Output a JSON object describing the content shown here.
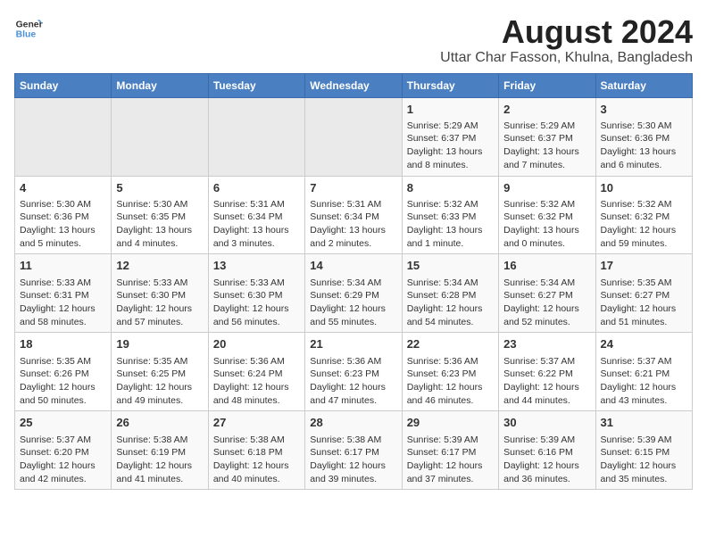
{
  "header": {
    "logo_line1": "General",
    "logo_line2": "Blue",
    "title": "August 2024",
    "subtitle": "Uttar Char Fasson, Khulna, Bangladesh"
  },
  "weekdays": [
    "Sunday",
    "Monday",
    "Tuesday",
    "Wednesday",
    "Thursday",
    "Friday",
    "Saturday"
  ],
  "weeks": [
    [
      {
        "day": "",
        "content": ""
      },
      {
        "day": "",
        "content": ""
      },
      {
        "day": "",
        "content": ""
      },
      {
        "day": "",
        "content": ""
      },
      {
        "day": "1",
        "content": "Sunrise: 5:29 AM\nSunset: 6:37 PM\nDaylight: 13 hours\nand 8 minutes."
      },
      {
        "day": "2",
        "content": "Sunrise: 5:29 AM\nSunset: 6:37 PM\nDaylight: 13 hours\nand 7 minutes."
      },
      {
        "day": "3",
        "content": "Sunrise: 5:30 AM\nSunset: 6:36 PM\nDaylight: 13 hours\nand 6 minutes."
      }
    ],
    [
      {
        "day": "4",
        "content": "Sunrise: 5:30 AM\nSunset: 6:36 PM\nDaylight: 13 hours\nand 5 minutes."
      },
      {
        "day": "5",
        "content": "Sunrise: 5:30 AM\nSunset: 6:35 PM\nDaylight: 13 hours\nand 4 minutes."
      },
      {
        "day": "6",
        "content": "Sunrise: 5:31 AM\nSunset: 6:34 PM\nDaylight: 13 hours\nand 3 minutes."
      },
      {
        "day": "7",
        "content": "Sunrise: 5:31 AM\nSunset: 6:34 PM\nDaylight: 13 hours\nand 2 minutes."
      },
      {
        "day": "8",
        "content": "Sunrise: 5:32 AM\nSunset: 6:33 PM\nDaylight: 13 hours\nand 1 minute."
      },
      {
        "day": "9",
        "content": "Sunrise: 5:32 AM\nSunset: 6:32 PM\nDaylight: 13 hours\nand 0 minutes."
      },
      {
        "day": "10",
        "content": "Sunrise: 5:32 AM\nSunset: 6:32 PM\nDaylight: 12 hours\nand 59 minutes."
      }
    ],
    [
      {
        "day": "11",
        "content": "Sunrise: 5:33 AM\nSunset: 6:31 PM\nDaylight: 12 hours\nand 58 minutes."
      },
      {
        "day": "12",
        "content": "Sunrise: 5:33 AM\nSunset: 6:30 PM\nDaylight: 12 hours\nand 57 minutes."
      },
      {
        "day": "13",
        "content": "Sunrise: 5:33 AM\nSunset: 6:30 PM\nDaylight: 12 hours\nand 56 minutes."
      },
      {
        "day": "14",
        "content": "Sunrise: 5:34 AM\nSunset: 6:29 PM\nDaylight: 12 hours\nand 55 minutes."
      },
      {
        "day": "15",
        "content": "Sunrise: 5:34 AM\nSunset: 6:28 PM\nDaylight: 12 hours\nand 54 minutes."
      },
      {
        "day": "16",
        "content": "Sunrise: 5:34 AM\nSunset: 6:27 PM\nDaylight: 12 hours\nand 52 minutes."
      },
      {
        "day": "17",
        "content": "Sunrise: 5:35 AM\nSunset: 6:27 PM\nDaylight: 12 hours\nand 51 minutes."
      }
    ],
    [
      {
        "day": "18",
        "content": "Sunrise: 5:35 AM\nSunset: 6:26 PM\nDaylight: 12 hours\nand 50 minutes."
      },
      {
        "day": "19",
        "content": "Sunrise: 5:35 AM\nSunset: 6:25 PM\nDaylight: 12 hours\nand 49 minutes."
      },
      {
        "day": "20",
        "content": "Sunrise: 5:36 AM\nSunset: 6:24 PM\nDaylight: 12 hours\nand 48 minutes."
      },
      {
        "day": "21",
        "content": "Sunrise: 5:36 AM\nSunset: 6:23 PM\nDaylight: 12 hours\nand 47 minutes."
      },
      {
        "day": "22",
        "content": "Sunrise: 5:36 AM\nSunset: 6:23 PM\nDaylight: 12 hours\nand 46 minutes."
      },
      {
        "day": "23",
        "content": "Sunrise: 5:37 AM\nSunset: 6:22 PM\nDaylight: 12 hours\nand 44 minutes."
      },
      {
        "day": "24",
        "content": "Sunrise: 5:37 AM\nSunset: 6:21 PM\nDaylight: 12 hours\nand 43 minutes."
      }
    ],
    [
      {
        "day": "25",
        "content": "Sunrise: 5:37 AM\nSunset: 6:20 PM\nDaylight: 12 hours\nand 42 minutes."
      },
      {
        "day": "26",
        "content": "Sunrise: 5:38 AM\nSunset: 6:19 PM\nDaylight: 12 hours\nand 41 minutes."
      },
      {
        "day": "27",
        "content": "Sunrise: 5:38 AM\nSunset: 6:18 PM\nDaylight: 12 hours\nand 40 minutes."
      },
      {
        "day": "28",
        "content": "Sunrise: 5:38 AM\nSunset: 6:17 PM\nDaylight: 12 hours\nand 39 minutes."
      },
      {
        "day": "29",
        "content": "Sunrise: 5:39 AM\nSunset: 6:17 PM\nDaylight: 12 hours\nand 37 minutes."
      },
      {
        "day": "30",
        "content": "Sunrise: 5:39 AM\nSunset: 6:16 PM\nDaylight: 12 hours\nand 36 minutes."
      },
      {
        "day": "31",
        "content": "Sunrise: 5:39 AM\nSunset: 6:15 PM\nDaylight: 12 hours\nand 35 minutes."
      }
    ]
  ]
}
